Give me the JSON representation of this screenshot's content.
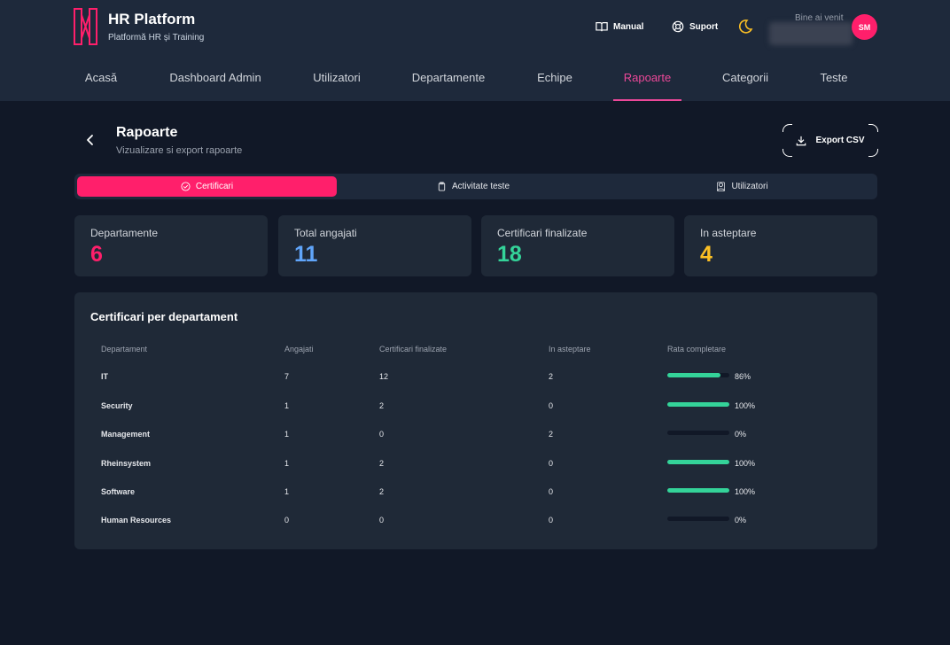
{
  "brand": {
    "title": "HR Platform",
    "subtitle": "Platformă HR și Training"
  },
  "header": {
    "manual_label": "Manual",
    "support_label": "Suport",
    "welcome_text": "Bine ai venit",
    "avatar_initials": "SM",
    "icons": [
      "book-icon",
      "lifebuoy-icon",
      "moon-icon"
    ]
  },
  "nav": {
    "items": [
      {
        "label": "Acasă"
      },
      {
        "label": "Dashboard Admin"
      },
      {
        "label": "Utilizatori"
      },
      {
        "label": "Departamente"
      },
      {
        "label": "Echipe"
      },
      {
        "label": "Rapoarte"
      },
      {
        "label": "Categorii"
      },
      {
        "label": "Teste"
      }
    ],
    "active": "Rapoarte"
  },
  "page": {
    "title": "Rapoarte",
    "subtitle": "Vizualizare si export rapoarte",
    "export_label": "Export CSV"
  },
  "tabs": {
    "items": [
      {
        "label": "Certificari",
        "icon": "check-circle-icon"
      },
      {
        "label": "Activitate teste",
        "icon": "clipboard-icon"
      },
      {
        "label": "Utilizatori",
        "icon": "users-icon"
      }
    ],
    "active": "Certificari"
  },
  "stats": [
    {
      "label": "Departamente",
      "value": "6",
      "color": "#ff1f6b"
    },
    {
      "label": "Total angajati",
      "value": "11",
      "color": "#60a5fa"
    },
    {
      "label": "Certificari finalizate",
      "value": "18",
      "color": "#34d399"
    },
    {
      "label": "In asteptare",
      "value": "4",
      "color": "#fbbf24"
    }
  ],
  "table": {
    "title": "Certificari per departament",
    "headers": [
      "Departament",
      "Angajati",
      "Certificari finalizate",
      "In asteptare",
      "Rata completare"
    ],
    "rows": [
      {
        "dept": "IT",
        "employees": "7",
        "completed": "12",
        "pending": "2",
        "rate": 0.86,
        "rate_label": "86%"
      },
      {
        "dept": "Security",
        "employees": "1",
        "completed": "2",
        "pending": "0",
        "rate": 1.0,
        "rate_label": "100%"
      },
      {
        "dept": "Management",
        "employees": "1",
        "completed": "0",
        "pending": "2",
        "rate": 0.0,
        "rate_label": "0%"
      },
      {
        "dept": "Rheinsystem",
        "employees": "1",
        "completed": "2",
        "pending": "0",
        "rate": 1.0,
        "rate_label": "100%"
      },
      {
        "dept": "Software",
        "employees": "1",
        "completed": "2",
        "pending": "0",
        "rate": 1.0,
        "rate_label": "100%"
      },
      {
        "dept": "Human Resources",
        "employees": "0",
        "completed": "0",
        "pending": "0",
        "rate": 0.0,
        "rate_label": "0%"
      }
    ],
    "bar_color": "#34d399"
  }
}
